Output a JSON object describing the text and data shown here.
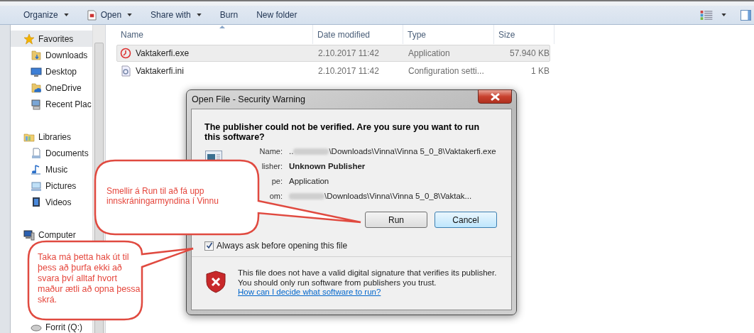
{
  "toolbar": {
    "items": [
      {
        "label": "Organize",
        "kind": "menu"
      },
      {
        "label": "Open",
        "kind": "open"
      },
      {
        "label": "Share with",
        "kind": "menu"
      },
      {
        "label": "Burn",
        "kind": "plain"
      },
      {
        "label": "New folder",
        "kind": "plain"
      }
    ]
  },
  "sidebar": {
    "groups": [
      {
        "label": "Favorites",
        "kind": "star",
        "selected": true,
        "children": [
          {
            "label": "Downloads",
            "kind": "downloads",
            "selected": false
          },
          {
            "label": "Desktop",
            "kind": "desktop",
            "selected": false
          },
          {
            "label": "OneDrive",
            "kind": "onedrive",
            "selected": false
          },
          {
            "label": "Recent Plac",
            "kind": "recent",
            "selected": false
          }
        ]
      },
      {
        "label": "Libraries",
        "kind": "library",
        "selected": false,
        "children": [
          {
            "label": "Documents",
            "kind": "documents",
            "selected": false
          },
          {
            "label": "Music",
            "kind": "music",
            "selected": false
          },
          {
            "label": "Pictures",
            "kind": "pictures",
            "selected": false
          },
          {
            "label": "Videos",
            "kind": "videos",
            "selected": false
          }
        ]
      },
      {
        "label": "Computer",
        "kind": "computer",
        "selected": false,
        "children": [
          {
            "label": "Forrit (Q:)",
            "kind": "drive",
            "selected": false
          }
        ]
      }
    ]
  },
  "table": {
    "columns": [
      "Name",
      "Date modified",
      "Type",
      "Size"
    ],
    "rows": [
      {
        "name": "Vaktakerfi.exe",
        "kind": "exe",
        "date": "2.10.2017 11:42",
        "type": "Application",
        "size": "57.940 KB",
        "selected": true
      },
      {
        "name": "Vaktakerfi.ini",
        "kind": "ini",
        "date": "2.10.2017 11:42",
        "type": "Configuration setti...",
        "size": "1 KB",
        "selected": false
      }
    ]
  },
  "dialog": {
    "title": "Open File - Security Warning",
    "heading": "The publisher could not be verified.  Are you sure you want to run this software?",
    "fields": [
      {
        "label": "Name:",
        "prefix": "..",
        "redacted": true,
        "value": "\\Downloads\\Vinna\\Vinna 5_0_8\\Vaktakerfi.exe",
        "bold": false
      },
      {
        "label": "lisher:",
        "redacted": false,
        "value": "Unknown Publisher",
        "bold": true
      },
      {
        "label": "pe:",
        "redacted": false,
        "value": "Application",
        "bold": false
      },
      {
        "label": "om:",
        "redacted": true,
        "value": "\\Downloads\\Vinna\\Vinna 5_0_8\\Vaktak...",
        "bold": false
      }
    ],
    "buttons": [
      {
        "label": "Run",
        "default": false
      },
      {
        "label": "Cancel",
        "default": true
      }
    ],
    "checkbox": {
      "label": "Always ask before opening this file",
      "checked": true
    },
    "warning": "This file does not have a valid digital signature that verifies its publisher. You should only run software from publishers you trust.",
    "link": "How can I decide what software to run?"
  },
  "callouts": [
    {
      "text": "Smellir á Run til að fá upp innskráningarmyndina í Vinnu"
    },
    {
      "text": "Taka má þetta hak út til þess að þurfa ekki að svara því alltaf hvort maður ætli að opna þessa skrá."
    }
  ]
}
